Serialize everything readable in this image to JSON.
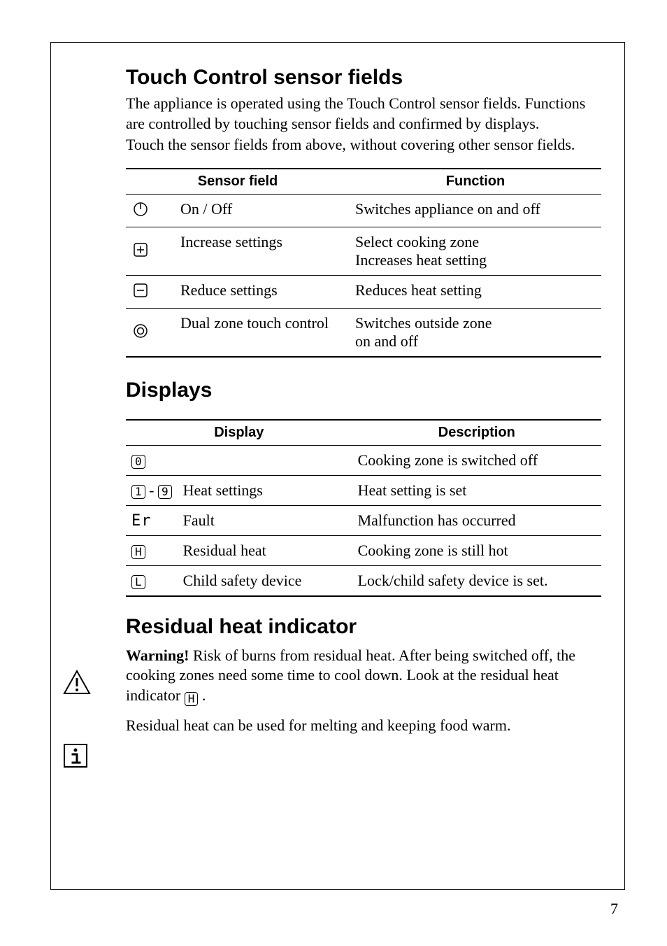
{
  "sections": {
    "touch": {
      "heading": "Touch Control sensor fields",
      "para1": "The appliance is operated using the Touch Control sensor fields. Functions are controlled by touching sensor fields and confirmed by displays.",
      "para2": "Touch the sensor fields from above, without covering other sensor fields.",
      "th1": "Sensor field",
      "th2": "Function",
      "rows": [
        {
          "label": "On / Off",
          "func": "Switches appliance on and off"
        },
        {
          "label": "Increase settings",
          "func": "Select cooking zone\nIncreases heat setting"
        },
        {
          "label": "Reduce settings",
          "func": "Reduces heat setting"
        },
        {
          "label": "Dual zone touch control",
          "func": "Switches outside zone\non and off"
        }
      ]
    },
    "displays": {
      "heading": "Displays",
      "th1": "Display",
      "th2": "Description",
      "rows": [
        {
          "seg": "0",
          "label": "",
          "desc": "Cooking zone is switched off"
        },
        {
          "seg_a": "1",
          "dash": " - ",
          "seg_b": "9",
          "label": "Heat settings",
          "desc": "Heat setting is set"
        },
        {
          "er": "Er",
          "label": "Fault",
          "desc": "Malfunction has occurred"
        },
        {
          "seg": "H",
          "label": "Residual heat",
          "desc": "Cooking zone is still hot"
        },
        {
          "seg": "L",
          "label": "Child safety device",
          "desc": "Lock/child safety device is set."
        }
      ]
    },
    "residual": {
      "heading": "Residual heat indicator",
      "warn_label": "Warning!",
      "warn_body": " Risk of burns from residual heat. After being switched off, the cooking zones need some time to cool down. Look at the residual heat indicator ",
      "warn_tail": " .",
      "info": "Residual heat can be used for melting and keeping food warm."
    }
  },
  "page_number": "7"
}
